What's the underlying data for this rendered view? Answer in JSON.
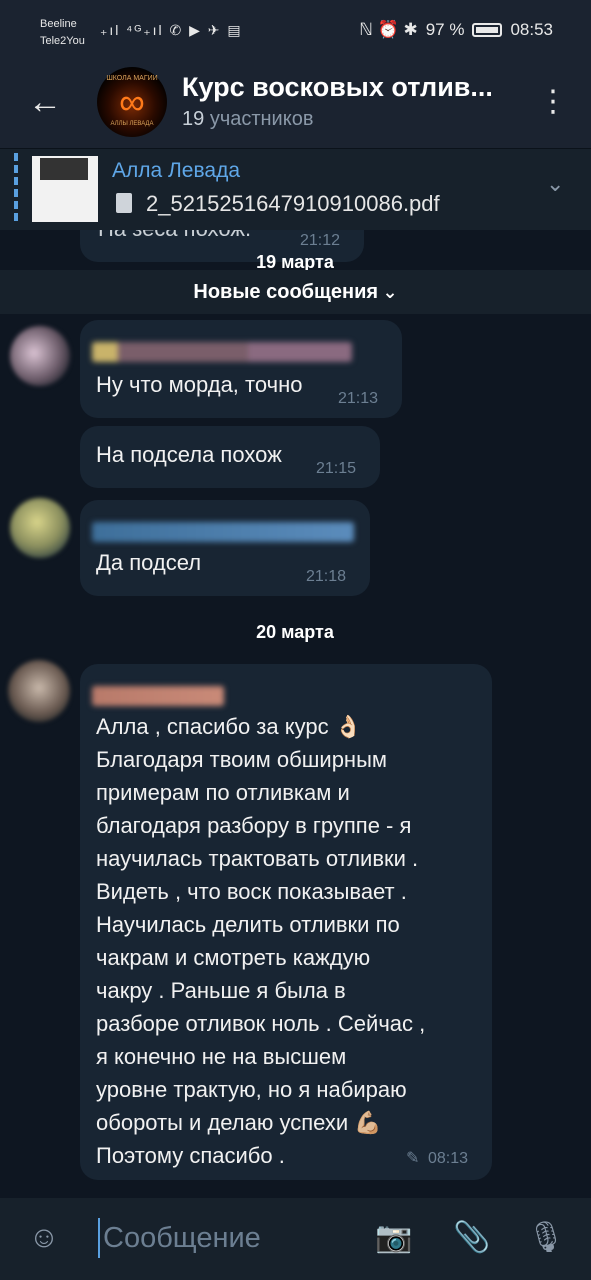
{
  "status_bar": {
    "carrier_1": "Beeline",
    "carrier_2": "Tele2You",
    "left_icons": "₊ıl ⁴ᴳ₊ıl ✆ ▶ ✈ ▤",
    "right_icons": "ℕ ⏰ ✱",
    "battery_percent": "97 %",
    "time": "08:53"
  },
  "header": {
    "title": "Курс восковых отлив...",
    "participants_count": "19",
    "participants_label": "участников",
    "avatar_top_text": "ШКОЛА МАГИИ",
    "avatar_bottom_text": "АЛЛЫ ЛЕВАДА"
  },
  "pinned": {
    "author": "Алла Левада",
    "file_name": "2_5215251647910910086.pdf"
  },
  "messages": {
    "partial": {
      "text": "На зеса похож.",
      "time": "21:12"
    },
    "date_1": "19 марта",
    "new_messages_label": "Новые сообщения",
    "m1": {
      "text": "Ну что морда, точно",
      "time": "21:13"
    },
    "m2": {
      "text": "На подсела похож",
      "time": "21:15"
    },
    "m3": {
      "text": "Да подсел",
      "time": "21:18"
    },
    "date_2": "20 марта",
    "m4": {
      "text": "Алла , спасибо за курс 👌🏻\nБлагодаря твоим обширным\nпримерам по отливкам и\nблагодаря разбору в группе - я\nнаучилась трактовать  отливки .\nВидеть , что воск показывает .\nНаучилась делить отливки по\nчакрам и смотреть каждую\nчакру . Раньше я была в\nразборе отливок ноль . Сейчас ,\nя конечно не на высшем\nуровне трактую, но я  набираю\nобороты и делаю успехи 💪🏼\nПоэтому спасибо .",
      "time": "08:13",
      "edited_icon": "✎"
    }
  },
  "input": {
    "placeholder": "Сообщение"
  },
  "colors": {
    "background": "#0e1621",
    "bubble": "#182533",
    "header": "#1b2330",
    "accent": "#5fa7e8"
  },
  "icons": {
    "back": "arrow-left-icon",
    "menu": "more-vertical-icon",
    "emoji": "emoji-icon",
    "camera": "camera-icon",
    "attach": "paperclip-icon",
    "mic": "microphone-icon",
    "chevron": "chevron-down-icon",
    "file": "file-icon"
  }
}
